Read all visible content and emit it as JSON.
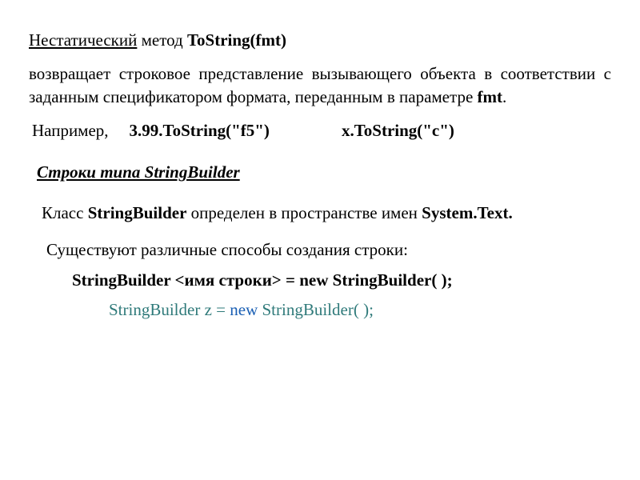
{
  "heading": {
    "underlined": "Нестатический",
    "rest1": " метод ",
    "method": "ToString(fmt)"
  },
  "desc": {
    "text1": "возвращает строковое представление вызывающего объекта в соответствии с заданным спецификатором формата, переданным в параметре ",
    "param": "fmt",
    "dot": "."
  },
  "example": {
    "label": "Например,",
    "ex1": "3.99.ToString(\"f5\")",
    "ex2": "x.ToString(\"c\")"
  },
  "sb_title": "Строки типа StringBuilder",
  "sb_desc": {
    "pre": "Класс ",
    "cls": "StringBuilder",
    "mid": " определен в пространстве имен ",
    "ns": "System.Text."
  },
  "ways_intro": "Существуют различные способы создания строки:",
  "code_tpl": {
    "p1": "StringBuilder <имя строки> = new StringBuilder( );"
  },
  "code_ex": {
    "p1": "StringBuilder z = ",
    "kw": "new",
    "p2": " StringBuilder( );"
  }
}
